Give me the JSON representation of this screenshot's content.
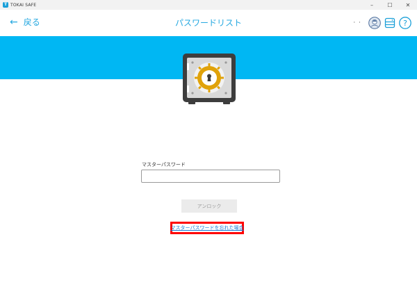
{
  "app": {
    "title": "TOKAI SAFE",
    "icon_letter": "T"
  },
  "window_controls": {
    "minimize": "–",
    "maximize": "☐",
    "close": "✕"
  },
  "header": {
    "back_label": "戻る",
    "back_arrow": "←",
    "title": "パスワードリスト",
    "dots": "· ·",
    "help": "?"
  },
  "colors": {
    "accent": "#25a8e0",
    "banner": "#00b7f3",
    "highlight": "#ff0000",
    "link": "#1a7bd4"
  },
  "form": {
    "password_label": "マスターパスワード",
    "password_value": "",
    "unlock_label": "アンロック",
    "forgot_link": "マスターパスワードを忘れた場合"
  },
  "icons": [
    "safe-icon",
    "avatar-icon",
    "storage-icon",
    "help-icon",
    "back-arrow-icon"
  ]
}
